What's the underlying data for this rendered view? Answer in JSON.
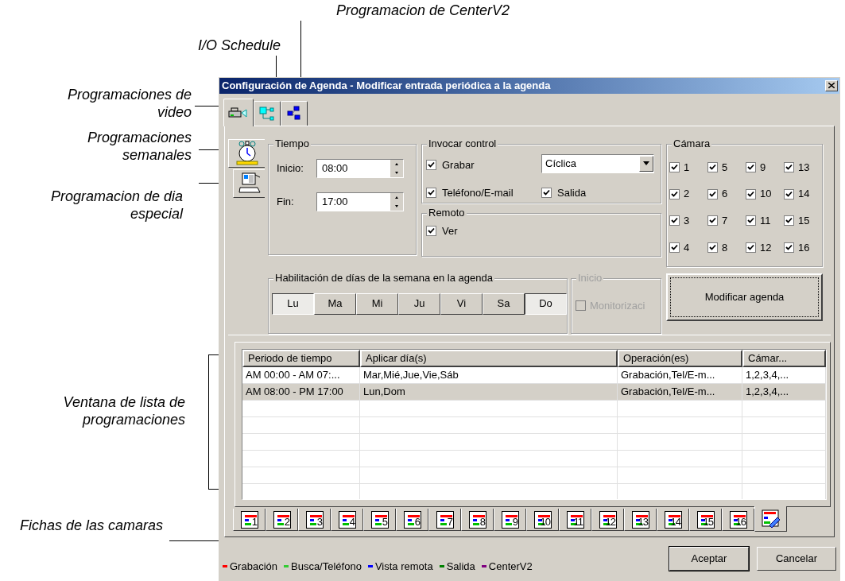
{
  "annotations": [
    {
      "text": "Programacion de CenterV2"
    },
    {
      "text": "I/O Schedule"
    },
    {
      "text": "Programaciones de video"
    },
    {
      "text": "Programaciones semanales"
    },
    {
      "text": "Programacion de dia especial"
    },
    {
      "text": "Ventana de lista de programaciones"
    },
    {
      "text": "Fichas de las camaras"
    }
  ],
  "window": {
    "title": "Configuración de Agenda - Modificar entrada periódica a la agenda"
  },
  "mode_tabs": [
    {
      "selected": true
    },
    {
      "selected": false
    },
    {
      "selected": false
    }
  ],
  "side_tabs": [
    {
      "selected": true
    },
    {
      "selected": false
    }
  ],
  "tiempo": {
    "title": "Tiempo",
    "fields": [
      {
        "label": "Inicio:",
        "value": "08:00"
      },
      {
        "label": "Fin:",
        "value": "17:00"
      }
    ]
  },
  "invocar": {
    "title": "Invocar control",
    "items": [
      {
        "label": "Grabar",
        "checked": true
      },
      {
        "label": "Teléfono/E-mail",
        "checked": true
      },
      {
        "label": "Salida",
        "checked": true
      }
    ],
    "mode": "Cíclica"
  },
  "remoto": {
    "title": "Remoto",
    "items": [
      {
        "label": "Ver",
        "checked": true
      }
    ]
  },
  "camara": {
    "title": "Cámara",
    "items": [
      {
        "label": "1",
        "checked": true
      },
      {
        "label": "5",
        "checked": true
      },
      {
        "label": "9",
        "checked": true
      },
      {
        "label": "13",
        "checked": true
      },
      {
        "label": "2",
        "checked": true
      },
      {
        "label": "6",
        "checked": true
      },
      {
        "label": "10",
        "checked": true
      },
      {
        "label": "14",
        "checked": true
      },
      {
        "label": "3",
        "checked": true
      },
      {
        "label": "7",
        "checked": true
      },
      {
        "label": "11",
        "checked": true
      },
      {
        "label": "15",
        "checked": true
      },
      {
        "label": "4",
        "checked": true
      },
      {
        "label": "8",
        "checked": true
      },
      {
        "label": "12",
        "checked": true
      },
      {
        "label": "16",
        "checked": true
      }
    ]
  },
  "days": {
    "title": "Habilitación de días de la semana en la agenda",
    "items": [
      {
        "label": "Lu",
        "selected": true
      },
      {
        "label": "Ma",
        "selected": false
      },
      {
        "label": "Mi",
        "selected": false
      },
      {
        "label": "Ju",
        "selected": false
      },
      {
        "label": "Vi",
        "selected": false
      },
      {
        "label": "Sa",
        "selected": false
      },
      {
        "label": "Do",
        "selected": true
      }
    ]
  },
  "inicio": {
    "title": "Inicio",
    "disabled": true,
    "label": "Monitorizaci",
    "checked": false
  },
  "modify_button": "Modificar agenda",
  "table": {
    "columns": [
      "Periodo de tiempo",
      "Aplicar día(s)",
      "Operación(es)",
      "Cámar..."
    ],
    "rows": [
      {
        "cells": [
          "AM 00:00 - AM 07:...",
          "Mar,Mié,Jue,Vie,Sáb",
          "Grabación,Tel/E-m...",
          "1,2,3,4,..."
        ],
        "selected": false
      },
      {
        "cells": [
          "AM 08:00 - PM 17:00",
          "Lun,Dom",
          "Grabación,Tel/E-m...",
          "1,2,3,4,..."
        ],
        "selected": true
      }
    ]
  },
  "camera_tabs": [
    {
      "kind": "camera",
      "label": "1",
      "selected": false
    },
    {
      "kind": "camera",
      "label": "2",
      "selected": false
    },
    {
      "kind": "camera",
      "label": "3",
      "selected": false
    },
    {
      "kind": "camera",
      "label": "4",
      "selected": false
    },
    {
      "kind": "camera",
      "label": "5",
      "selected": false
    },
    {
      "kind": "camera",
      "label": "6",
      "selected": false
    },
    {
      "kind": "camera",
      "label": "7",
      "selected": false
    },
    {
      "kind": "camera",
      "label": "8",
      "selected": false
    },
    {
      "kind": "camera",
      "label": "9",
      "selected": false
    },
    {
      "kind": "camera",
      "label": "10",
      "selected": false
    },
    {
      "kind": "camera",
      "label": "11",
      "selected": false
    },
    {
      "kind": "camera",
      "label": "12",
      "selected": false
    },
    {
      "kind": "camera",
      "label": "13",
      "selected": false
    },
    {
      "kind": "camera",
      "label": "14",
      "selected": false
    },
    {
      "kind": "camera",
      "label": "15",
      "selected": false
    },
    {
      "kind": "camera",
      "label": "16",
      "selected": false
    },
    {
      "kind": "edit",
      "selected": true
    }
  ],
  "legend": [
    {
      "label": "Grabación",
      "color": "#ff0000"
    },
    {
      "label": "Busca/Teléfono",
      "color": "#33cc33"
    },
    {
      "label": "Vista remota",
      "color": "#0000ff"
    },
    {
      "label": "Salida",
      "color": "#008000"
    },
    {
      "label": "CenterV2",
      "color": "#800080"
    }
  ],
  "buttons": [
    "Aceptar",
    "Cancelar"
  ]
}
